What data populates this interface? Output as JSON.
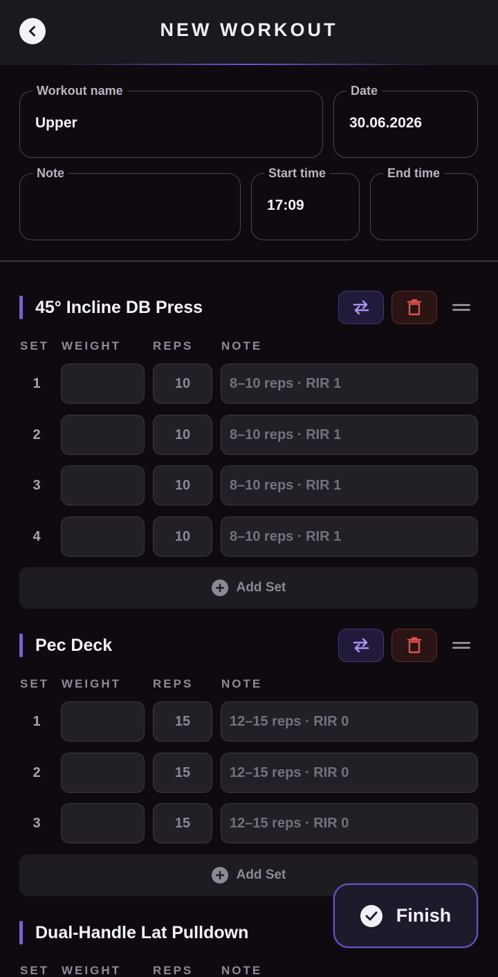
{
  "header": {
    "title": "NEW WORKOUT"
  },
  "form": {
    "workout_name": {
      "label": "Workout name",
      "value": "Upper"
    },
    "date": {
      "label": "Date",
      "value": "30.06.2026"
    },
    "note": {
      "label": "Note",
      "value": ""
    },
    "start_time": {
      "label": "Start time",
      "value": "17:09"
    },
    "end_time": {
      "label": "End time",
      "value": ""
    }
  },
  "columns": {
    "set": "SET",
    "weight": "WEIGHT",
    "reps": "REPS",
    "note": "NOTE"
  },
  "exercises": [
    {
      "name": "45° Incline DB Press",
      "sets": [
        {
          "num": "1",
          "weight": "",
          "reps": "10",
          "note": "8–10 reps · RIR 1"
        },
        {
          "num": "2",
          "weight": "",
          "reps": "10",
          "note": "8–10 reps · RIR 1"
        },
        {
          "num": "3",
          "weight": "",
          "reps": "10",
          "note": "8–10 reps · RIR 1"
        },
        {
          "num": "4",
          "weight": "",
          "reps": "10",
          "note": "8–10 reps · RIR 1"
        }
      ],
      "add_set_label": "Add Set"
    },
    {
      "name": "Pec Deck",
      "sets": [
        {
          "num": "1",
          "weight": "",
          "reps": "15",
          "note": "12–15 reps · RIR 0"
        },
        {
          "num": "2",
          "weight": "",
          "reps": "15",
          "note": "12–15 reps · RIR 0"
        },
        {
          "num": "3",
          "weight": "",
          "reps": "15",
          "note": "12–15 reps · RIR 0"
        }
      ],
      "add_set_label": "Add Set"
    },
    {
      "name": "Dual-Handle Lat Pulldown"
    }
  ],
  "finish": {
    "label": "Finish"
  },
  "colors": {
    "background": "#0e0a10",
    "accent": "#7a62cf",
    "danger": "#e0524f",
    "swap_icon": "#a994f0"
  },
  "icons": {
    "back": "chevron-left-icon",
    "swap": "swap-arrows-icon",
    "delete": "trash-icon",
    "drag": "drag-handle-icon",
    "add": "plus-circle-icon",
    "finish": "check-circle-icon"
  }
}
